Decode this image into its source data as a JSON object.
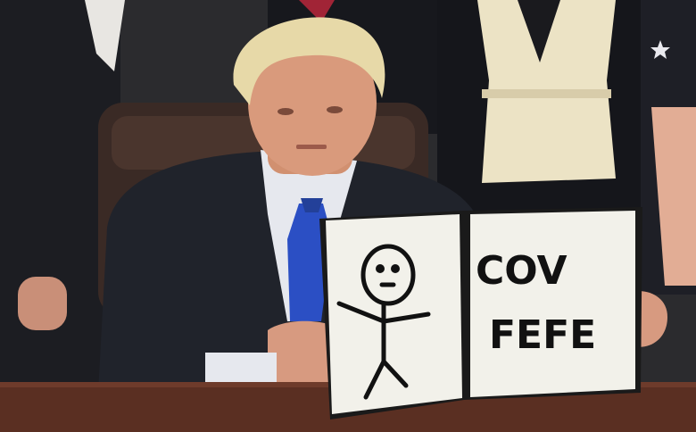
{
  "scene": {
    "description_colors": {
      "background": "#2b2b2e",
      "suit": "#20232b",
      "tie": "#2b4fc4",
      "hair": "#e7d9a8",
      "skin": "#d99a7c",
      "board": "#f2f1ea",
      "desk": "#5a2f22",
      "chair": "#3a2a25"
    },
    "board": {
      "right_page_lines": [
        "COV",
        "FEFE"
      ]
    },
    "icons": [
      "stick-figure-drawing",
      "star-pin-icon"
    ]
  }
}
